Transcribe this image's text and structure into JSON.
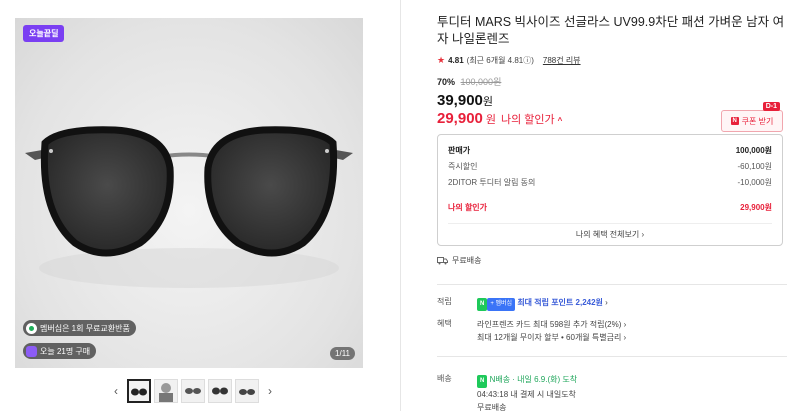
{
  "gallery": {
    "today_badge": "오늘끝딜",
    "membership_chip": "멤버십은 1회 무료교환반품",
    "buyers_chip": "오늘 21명 구매",
    "counter": "1/11",
    "prev_arrow": "‹",
    "next_arrow": "›"
  },
  "product": {
    "title": "투디터 MARS 빅사이즈 선글라스 UV99.9차단 패션 가벼운 남자 여자 나일론렌즈",
    "rating_score": "4.81",
    "rating_detail": "(최근 6개월 4.81ⓘ)",
    "review_count": "788건 리뷰",
    "discount_pct": "70%",
    "original_price": "100,000원",
    "price": "39,900",
    "price_unit": "원",
    "my_price": "29,900",
    "my_price_unit": "원",
    "my_price_label": "나의 할인가",
    "my_price_caret": "^"
  },
  "coupon": {
    "dday": "D-1",
    "icon": "N",
    "label": "쿠폰 받기"
  },
  "breakdown": {
    "rows": [
      {
        "label": "판매가",
        "value": "100,000원"
      },
      {
        "label": "즉시할인",
        "value": "-60,100원"
      },
      {
        "label": "2DITOR 투디터 알림 동의",
        "value": "-10,000원"
      }
    ],
    "my_label": "나의 할인가",
    "my_value": "29,900원",
    "footer": "나의 혜택 전체보기 ›"
  },
  "shipping_small": "무료배송",
  "points": {
    "key": "적립",
    "npay": "N",
    "npay_plus": "+ 멤버십",
    "text": "최대 적립 포인트",
    "amount": "2,242원",
    "arrow": "›"
  },
  "benefits": {
    "key": "혜택",
    "line1": "라인프렌즈 카드 최대 598원 추가 적립(2%) ›",
    "line2": "최대 12개월 무이자 할부 • 60개월 특별금리 ›"
  },
  "delivery": {
    "key": "배송",
    "badge": "N",
    "line1": "N배송 · 내일 6.9.(화) 도착",
    "line2": "04:43:18  내 결제 시 내일도착",
    "line3": "무료배송"
  },
  "colors": {
    "accent_red": "#e8203a",
    "purple": "#7a3ff2",
    "green": "#1ea65a"
  }
}
